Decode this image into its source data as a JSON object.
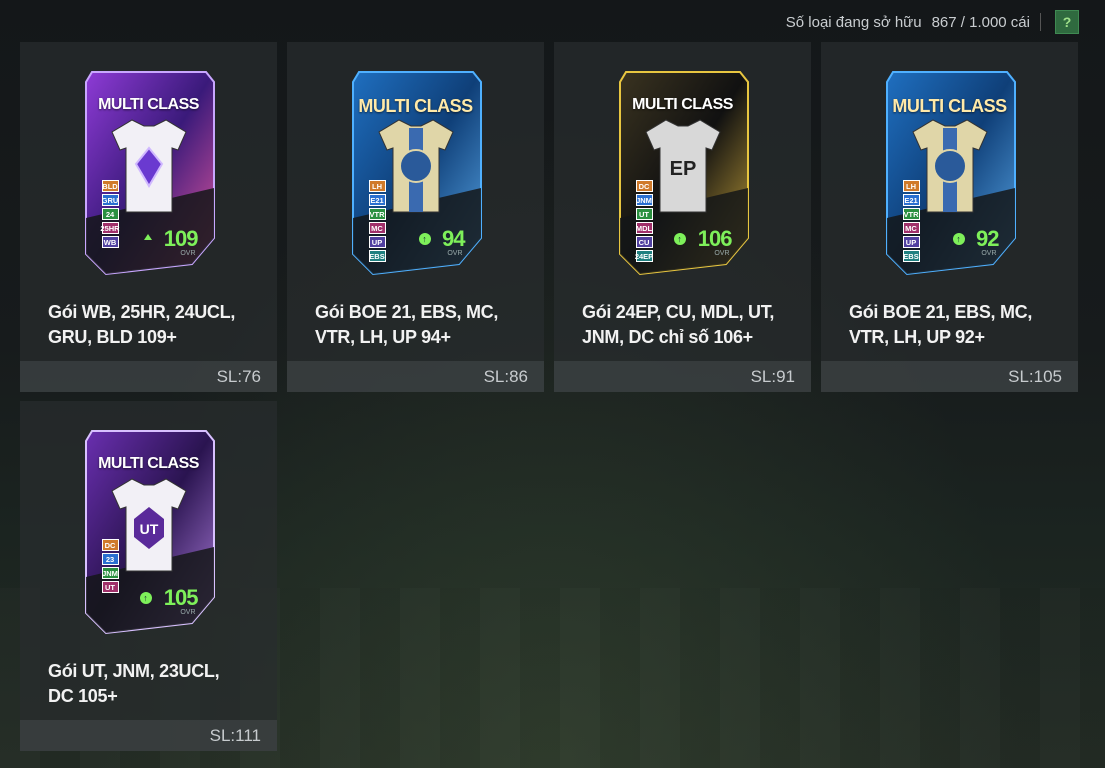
{
  "header": {
    "label": "Số loại đang sở hữu",
    "value": "867 / 1.000 cái",
    "help": "?"
  },
  "packs": [
    {
      "title": "Gói WB, 25HR, 24UCL, GRU, BLD 109+",
      "qty": "SL:76",
      "card_label": "MULTI CLASS",
      "ovr": "109",
      "ovr_tag": "OVR",
      "badges": [
        "BLD",
        "GRU",
        "24",
        "25HR",
        "WB"
      ],
      "theme": "purple-holo"
    },
    {
      "title": "Gói BOE 21, EBS, MC, VTR, LH, UP 94+",
      "qty": "SL:86",
      "card_label": "MULTI CLASS",
      "ovr": "94",
      "ovr_tag": "OVR",
      "badges": [
        "LH",
        "E21",
        "VTR",
        "MC",
        "UP",
        "EBS"
      ],
      "theme": "blue"
    },
    {
      "title": "Gói 24EP, CU, MDL, UT, JNM, DC chỉ số 106+",
      "qty": "SL:91",
      "card_label": "MULTI CLASS",
      "ovr": "106",
      "ovr_tag": "OVR",
      "badges": [
        "DC",
        "JNM",
        "UT",
        "MDL",
        "CU",
        "24EP"
      ],
      "theme": "gold-dark"
    },
    {
      "title": "Gói BOE 21, EBS, MC, VTR, LH, UP 92+",
      "qty": "SL:105",
      "card_label": "MULTI CLASS",
      "ovr": "92",
      "ovr_tag": "OVR",
      "badges": [
        "LH",
        "E21",
        "VTR",
        "MC",
        "UP",
        "EBS"
      ],
      "theme": "blue"
    },
    {
      "title": "Gói UT, JNM, 23UCL, DC 105+",
      "qty": "SL:111",
      "card_label": "MULTI CLASS",
      "ovr": "105",
      "ovr_tag": "OVR",
      "badges": [
        "DC",
        "23",
        "JNM",
        "UT"
      ],
      "theme": "violet-ut"
    }
  ],
  "colors": {
    "accent_green": "#7ef05a",
    "help_button": "#2f6a3f",
    "tile_bg": "#282c2e"
  }
}
